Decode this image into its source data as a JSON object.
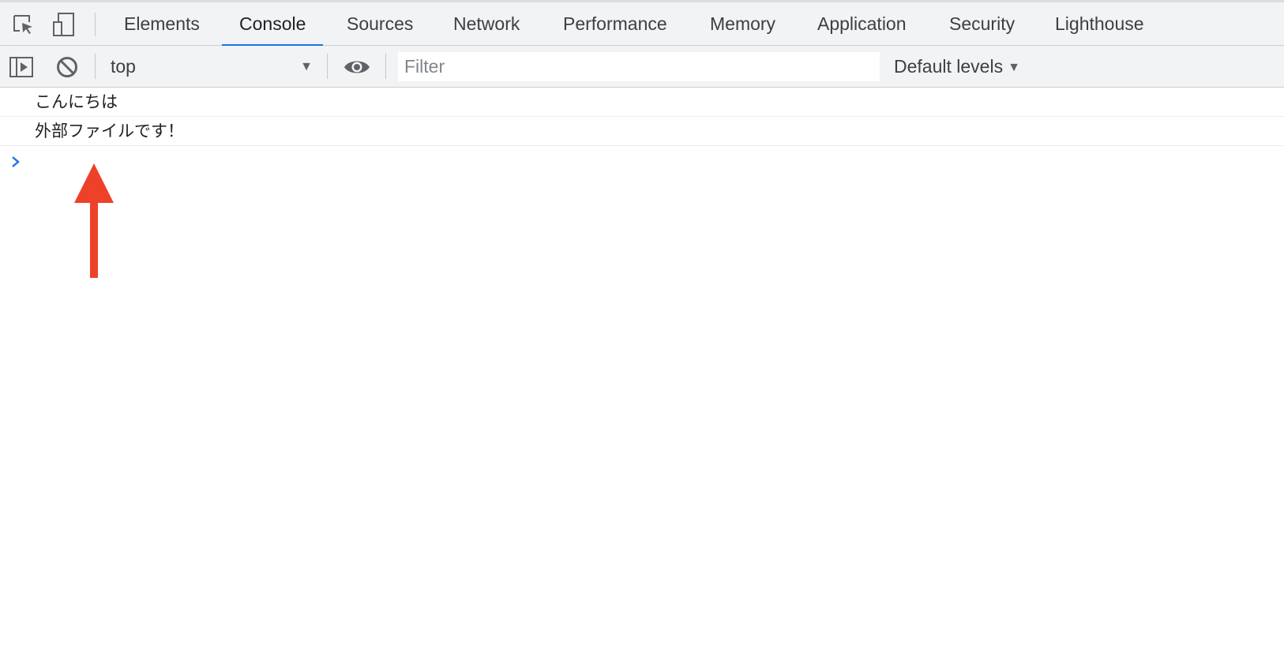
{
  "toolbar_tabs": {
    "items": [
      {
        "label": "Elements",
        "active": false
      },
      {
        "label": "Console",
        "active": true
      },
      {
        "label": "Sources",
        "active": false
      },
      {
        "label": "Network",
        "active": false
      },
      {
        "label": "Performance",
        "active": false
      },
      {
        "label": "Memory",
        "active": false
      },
      {
        "label": "Application",
        "active": false
      },
      {
        "label": "Security",
        "active": false
      },
      {
        "label": "Lighthouse",
        "active": false
      }
    ],
    "icons": [
      "inspect-element-icon",
      "device-toolbar-icon"
    ]
  },
  "console_toolbar": {
    "context": "top",
    "filter_placeholder": "Filter",
    "levels": "Default levels",
    "icons": [
      "sidebar-toggle-icon",
      "clear-console-icon",
      "live-expression-eye-icon"
    ]
  },
  "console": {
    "messages": [
      "こんにちは",
      "外部ファイルです！"
    ],
    "prompt_icon": "chevron-right-icon"
  },
  "annotation": {
    "type": "arrow-up",
    "color": "#ee4129"
  },
  "colors": {
    "accent": "#1a73e8",
    "toolbar_bg": "#f1f3f4",
    "annotation": "#ee4129"
  }
}
